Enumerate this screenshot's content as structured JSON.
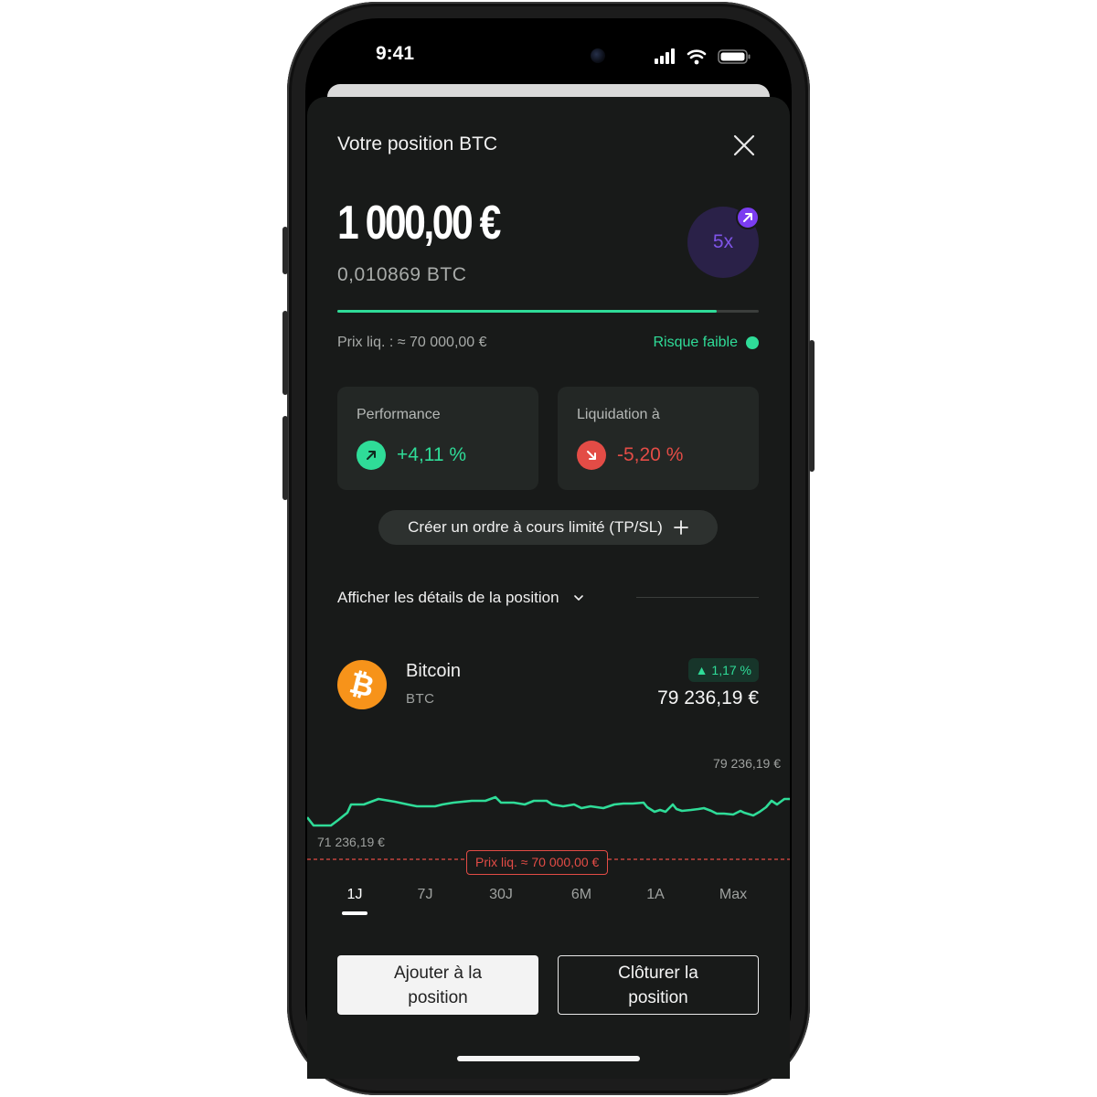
{
  "status_bar": {
    "time": "9:41"
  },
  "sheet": {
    "title": "Votre position BTC",
    "amount": "1 000,00 €",
    "amount_btc": "0,010869 BTC",
    "leverage": "5x",
    "risk_progress_percent": 90,
    "liq_price_label": "Prix liq. : ≈ 70 000,00 €",
    "risk_label": "Risque faible",
    "performance_label": "Performance",
    "performance_value": "+4,11 %",
    "liquidation_label": "Liquidation à",
    "liquidation_value": "-5,20 %",
    "order_button": "Créer un ordre à cours limité (TP/SL)",
    "details_label": "Afficher les détails de la position"
  },
  "asset": {
    "name": "Bitcoin",
    "ticker": "BTC",
    "change": "▲ 1,17 %",
    "price": "79 236,19 €",
    "chart_high_label": "79 236,19 €",
    "chart_low_label": "71 236,19 €",
    "liq_tag": "Prix liq. ≈ 70 000,00 €"
  },
  "timeframes": [
    "1J",
    "7J",
    "30J",
    "6M",
    "1A",
    "Max"
  ],
  "active_timeframe": "1J",
  "actions": {
    "add": "Ajouter à la position",
    "close": "Clôturer la position"
  },
  "colors": {
    "positive": "#2fdc98",
    "negative": "#e34c46",
    "leverage": "#7b3df0",
    "bitcoin": "#f7931a"
  },
  "icons": [
    "close-icon",
    "arrow-up-right-icon",
    "arrow-down-right-icon",
    "plus-icon",
    "chevron-down-icon",
    "bitcoin-icon"
  ]
}
